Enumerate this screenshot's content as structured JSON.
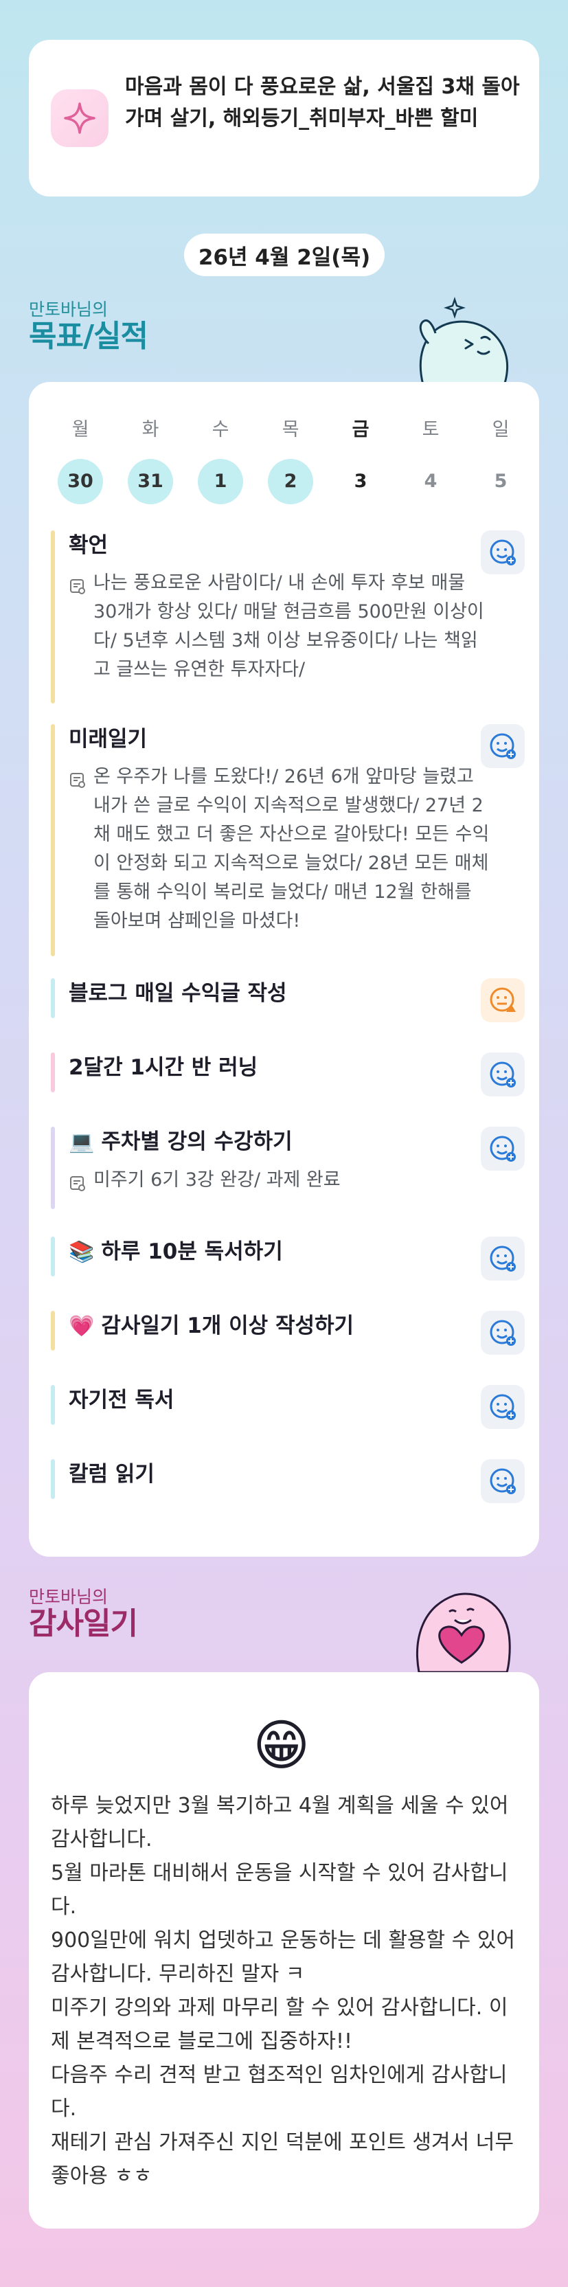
{
  "motto": {
    "icon": "sparkle-icon",
    "text": "마음과 몸이 다 풍요로운 삶, 서울집 3채 돌아가며 살기, 해외등기_취미부자_바쁜 할미"
  },
  "date": "26년 4월 2일(목)",
  "goals_section": {
    "small": "만토바님의",
    "big": "목표/실적"
  },
  "week": [
    {
      "name": "월",
      "date": "30",
      "state": "done"
    },
    {
      "name": "화",
      "date": "31",
      "state": "done"
    },
    {
      "name": "수",
      "date": "1",
      "state": "done"
    },
    {
      "name": "목",
      "date": "2",
      "state": "done"
    },
    {
      "name": "금",
      "date": "3",
      "state": "today"
    },
    {
      "name": "토",
      "date": "4",
      "state": "future"
    },
    {
      "name": "일",
      "date": "5",
      "state": "future"
    }
  ],
  "goals": [
    {
      "title": "확언",
      "emoji": "",
      "bar": "#f5dfa0",
      "face": "smile",
      "note": "나는 풍요로운 사람이다/ 내 손에 투자 후보 매물 30개가 항상 있다/ 매달 현금흐름 500만원 이상이다/ 5년후 시스템 3채 이상 보유중이다/ 나는 책읽고 글쓰는 유연한 투자자다/"
    },
    {
      "title": "미래일기",
      "emoji": "",
      "bar": "#f5dfa0",
      "face": "smile",
      "note": "온 우주가 나를 도왔다!/ 26년 6개 앞마당 늘렸고 내가 쓴 글로 수익이 지속적으로 발생했다/ 27년 2채 매도 했고 더 좋은 자산으로 갈아탔다! 모든 수익이 안정화 되고 지속적으로 늘었다/ 28년 모든 매체를 통해 수익이 복리로 늘었다/ 매년 12월 한해를 돌아보며 샴페인을 마셨다!"
    },
    {
      "title": "블로그 매일 수익글 작성",
      "emoji": "",
      "bar": "#c6ecf2",
      "face": "warn",
      "note": ""
    },
    {
      "title": "2달간 1시간 반 러닝",
      "emoji": "",
      "bar": "#f9c9dd",
      "face": "smile",
      "note": ""
    },
    {
      "title": "주차별 강의 수강하기",
      "emoji": "💻",
      "bar": "#dcd6f3",
      "face": "smile",
      "note": "미주기 6기 3강 완강/ 과제 완료"
    },
    {
      "title": "하루 10분 독서하기",
      "emoji": "📚",
      "bar": "#c6ecf2",
      "face": "smile",
      "note": ""
    },
    {
      "title": "감사일기 1개 이상 작성하기",
      "emoji": "💗",
      "bar": "#f5dfa0",
      "face": "smile",
      "note": ""
    },
    {
      "title": "자기전 독서",
      "emoji": "",
      "bar": "#c6ecf2",
      "face": "smile",
      "note": ""
    },
    {
      "title": "칼럼 읽기",
      "emoji": "",
      "bar": "#c6ecf2",
      "face": "smile",
      "note": ""
    }
  ],
  "thanks_section": {
    "small": "만토바님의",
    "big": "감사일기"
  },
  "thanks": {
    "emoji": "😁",
    "lines": [
      "하루 늦었지만 3월 복기하고 4월 계획을 세울 수 있어 감사합니다.",
      "5월 마라톤 대비해서 운동을 시작할 수 있어 감사합니다.",
      "900일만에 워치 업뎃하고 운동하는 데 활용할 수 있어 감사합니다. 무리하진 말자 ㅋ",
      "미주기 강의와 과제 마무리 할 수 있어 감사합니다. 이제 본격적으로 블로그에 집중하자!!",
      "다음주 수리 견적 받고 협조적인 임차인에게 감사합니다.",
      "재테기 관심 가져주신 지인 덕분에 포인트 생겨서 너무 좋아용 ㅎㅎ"
    ]
  }
}
